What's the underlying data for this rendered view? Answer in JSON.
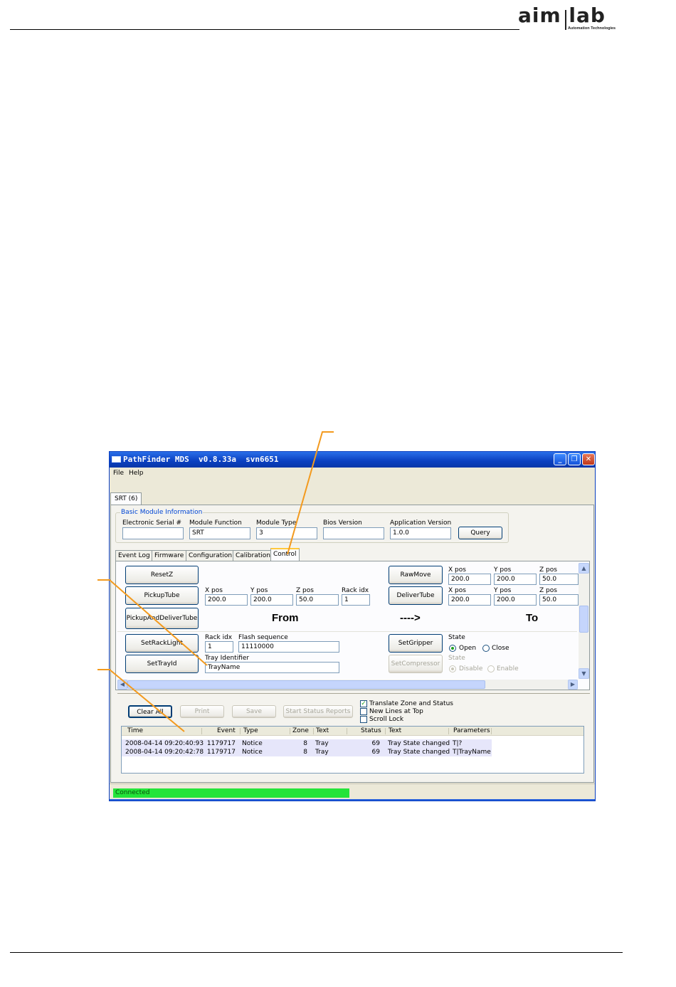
{
  "logo": {
    "main": "aim lab",
    "sub": "Automation Technologies"
  },
  "window": {
    "title": "PathFinder MDS  v0.8.33a  svn6651",
    "buttons": {
      "minimize": "_",
      "maximize": "❐",
      "close": "✕"
    },
    "menu": [
      "File",
      "Help"
    ],
    "outer_tab": "SRT (6)",
    "basic_info": {
      "legend": "Basic Module Information",
      "fields": [
        {
          "label": "Electronic Serial #",
          "value": ""
        },
        {
          "label": "Module Function",
          "value": "SRT"
        },
        {
          "label": "Module Type",
          "value": "3"
        },
        {
          "label": "Bios Version",
          "value": ""
        },
        {
          "label": "Application Version",
          "value": "1.0.0"
        }
      ],
      "query_button": "Query"
    },
    "tabs": [
      "Event Log",
      "Firmware",
      "Configuration",
      "Calibration",
      "Control"
    ],
    "active_tab": "Control",
    "control": {
      "buttons": {
        "reset_z": "ResetZ",
        "pickup_tube": "PickupTube",
        "pickup_and_deliver": "PickupAndDeliverTube",
        "raw_move": "RawMove",
        "deliver_tube": "DeliverTube",
        "set_rack_light": "SetRackLight",
        "set_tray_id": "SetTrayId",
        "set_gripper": "SetGripper",
        "set_compressor": "SetCompressor"
      },
      "labels": {
        "x_pos": "X pos",
        "y_pos": "Y pos",
        "z_pos": "Z pos",
        "rack_idx": "Rack idx",
        "flash_sequence": "Flash sequence",
        "tray_identifier": "Tray Identifier",
        "state": "State",
        "open": "Open",
        "close": "Close",
        "disable": "Disable",
        "enable": "Enable",
        "from": "From",
        "arrow": "---->",
        "to": "To"
      },
      "from_values": {
        "x": "200.0",
        "y": "200.0",
        "z": "50.0",
        "rack": "1"
      },
      "raw_move_values": {
        "x": "200.0",
        "y": "200.0",
        "z": "50.0"
      },
      "to_values": {
        "x": "200.0",
        "y": "200.0",
        "z": "50.0"
      },
      "rack_light": {
        "rack": "1",
        "flash": "11110000"
      },
      "tray_name": "TrayName"
    },
    "log": {
      "buttons": {
        "clear_all": "Clear All",
        "print": "Print",
        "save": "Save",
        "start_status": "Start Status Reports"
      },
      "options": {
        "translate": "Translate Zone and Status",
        "new_lines": "New Lines at Top",
        "scroll_lock": "Scroll Lock"
      },
      "options_checked": {
        "translate": true,
        "new_lines": false,
        "scroll_lock": false
      },
      "columns": [
        "Time",
        "Event",
        "Type",
        "Zone",
        "Text",
        "Status",
        "Text",
        "Parameters"
      ],
      "rows": [
        [
          "2008-04-14  09:20:40:93",
          "1179717",
          "Notice",
          "8",
          "Tray",
          "69",
          "Tray State changed",
          "T|?"
        ],
        [
          "2008-04-14  09:20:42:78",
          "1179717",
          "Notice",
          "8",
          "Tray",
          "69",
          "Tray State changed",
          "T|TrayName"
        ]
      ]
    },
    "status": {
      "text": "Connected",
      "color": "#24e43a"
    }
  }
}
